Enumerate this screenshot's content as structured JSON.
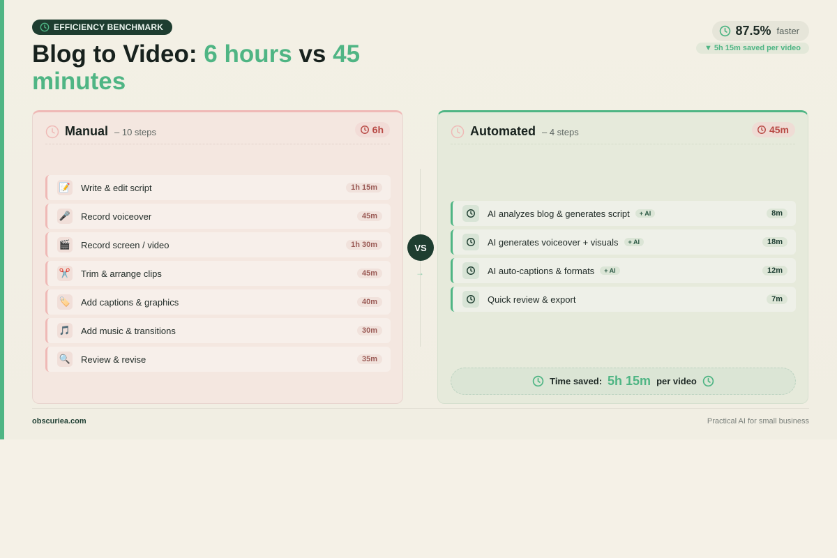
{
  "colors": {
    "accent": "#4fb584",
    "dark_green": "#1e3d30",
    "manual_red": "#b84a45",
    "manual_border": "#efb9b6",
    "background": "#f5f1e7"
  },
  "badge": {
    "icon": "clock-icon",
    "label": "EFFICIENCY BENCHMARK"
  },
  "headline": {
    "part1": "Blog to Video: ",
    "highlight1": "6 hours",
    "part2": " vs ",
    "highlight2": "45 minutes"
  },
  "stat": {
    "icon": "clock-icon",
    "value": "87.5%",
    "label": "faster",
    "saved": "▼ 5h 15m saved per video"
  },
  "manual": {
    "title": "Manual",
    "subtitle": "– 10 steps",
    "total": "6h",
    "steps": [
      {
        "icon": "📝",
        "icon_name": "memo-icon",
        "label": "Write & edit script",
        "duration": "1h 15m"
      },
      {
        "icon": "🎤",
        "icon_name": "microphone-icon",
        "label": "Record voiceover",
        "duration": "45m"
      },
      {
        "icon": "🎬",
        "icon_name": "clapperboard-icon",
        "label": "Record screen / video",
        "duration": "1h 30m"
      },
      {
        "icon": "✂️",
        "icon_name": "scissors-icon",
        "label": "Trim & arrange clips",
        "duration": "45m"
      },
      {
        "icon": "🏷️",
        "icon_name": "label-tag-icon",
        "label": "Add captions & graphics",
        "duration": "40m"
      },
      {
        "icon": "🎵",
        "icon_name": "music-note-icon",
        "label": "Add music & transitions",
        "duration": "30m"
      },
      {
        "icon": "🔍",
        "icon_name": "magnifier-icon",
        "label": "Review & revise",
        "duration": "35m"
      }
    ]
  },
  "automated": {
    "title": "Automated",
    "subtitle": "– 4 steps",
    "total": "45m",
    "ai_tag": "+ AI",
    "steps": [
      {
        "label": "AI analyzes blog & generates script",
        "duration": "8m",
        "ai": true
      },
      {
        "label": "AI generates voiceover + visuals",
        "duration": "18m",
        "ai": true
      },
      {
        "label": "AI auto-captions & formats",
        "duration": "12m",
        "ai": true
      },
      {
        "label": "Quick review & export",
        "duration": "7m",
        "ai": false
      }
    ],
    "time_saved": {
      "label": "Time saved:",
      "value": "5h 15m",
      "suffix": "per video"
    }
  },
  "vs": {
    "label": "VS",
    "arrow": "→"
  },
  "footer": {
    "site": "obscuriea.com",
    "tagline": "Practical AI for small business"
  }
}
